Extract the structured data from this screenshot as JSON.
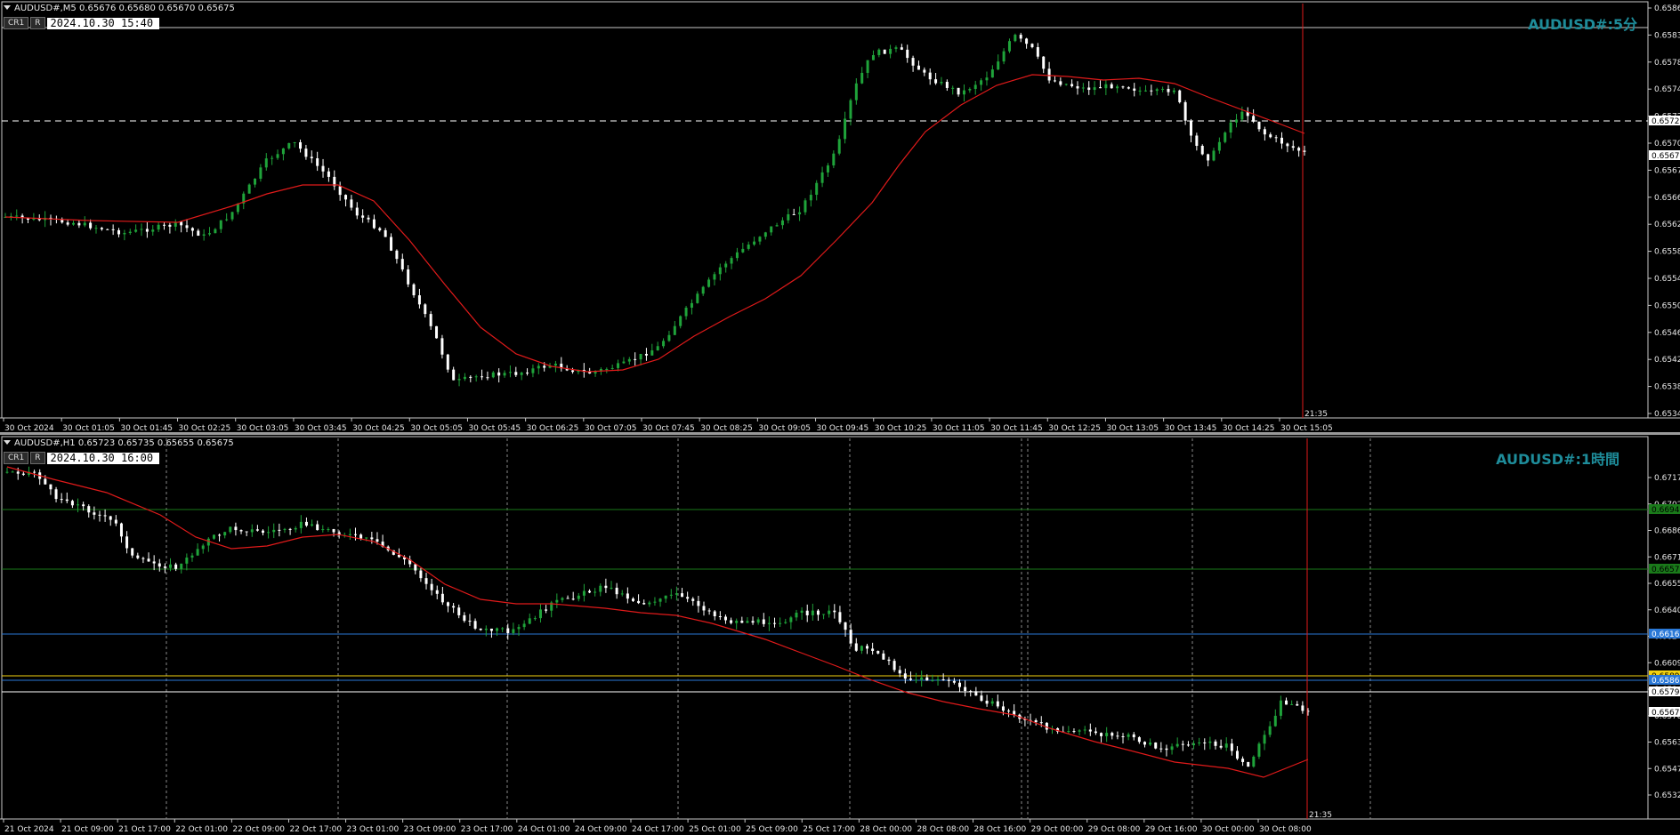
{
  "chart1": {
    "header": "AUDUSD#,M5  0.65676 0.65680 0.65670 0.65675",
    "btn_cr1": "CR1",
    "btn_r": "R",
    "datetime": "2024.10.30 15:40",
    "tf_label": "AUDUSD#:5分",
    "cursor_time": "21:35",
    "price_labels": [
      "0.65866",
      "0.65835",
      "0.65785",
      "0.65745",
      "0.65720",
      "0.65705",
      "0.65675",
      "0.65665",
      "0.65625",
      "0.65585",
      "0.65545",
      "0.65505",
      "0.65465",
      "0.65425",
      "0.65385",
      "0.65345"
    ],
    "time_labels": [
      "30 Oct 2024",
      "30 Oct 01:05",
      "30 Oct 01:45",
      "30 Oct 02:25",
      "30 Oct 03:05",
      "30 Oct 03:45",
      "30 Oct 04:25",
      "30 Oct 05:05",
      "30 Oct 05:45",
      "30 Oct 06:25",
      "30 Oct 07:05",
      "30 Oct 07:45",
      "30 Oct 08:25",
      "30 Oct 09:05",
      "30 Oct 09:45",
      "30 Oct 10:25",
      "30 Oct 11:05",
      "30 Oct 11:45",
      "30 Oct 12:25",
      "30 Oct 13:05",
      "30 Oct 13:45",
      "30 Oct 14:25",
      "30 Oct 15:05"
    ],
    "current_price": "0.65675",
    "dashed_level": "0.65720",
    "colors": {
      "bull": "#1fa33a",
      "bear": "#ffffff",
      "ma": "#e01a1a",
      "vline": "#e01a1a",
      "tf_label": "#1e8c9a"
    }
  },
  "chart2": {
    "header": "AUDUSD#,H1  0.65723 0.65735 0.65655 0.65675",
    "btn_cr1": "CR1",
    "btn_r": "R",
    "datetime": "2024.10.30 16:00",
    "tf_label": "AUDUSD#:1時間",
    "cursor_time": "21:35",
    "price_labels": [
      "0.67175",
      "0.67020",
      "0.66865",
      "0.66710",
      "0.66555",
      "0.66400",
      "0.66245",
      "0.66095",
      "0.65940",
      "0.65785",
      "0.65630",
      "0.65475",
      "0.65320"
    ],
    "level_labels": [
      {
        "text": "0.66947",
        "color": "#1a7a1a",
        "fg": "#000"
      },
      {
        "text": "0.66573",
        "color": "#1a7a1a",
        "fg": "#000"
      },
      {
        "text": "0.66160",
        "color": "#2a78d6",
        "fg": "#fff"
      },
      {
        "text": "0.65898",
        "color": "#f2d20f",
        "fg": "#000"
      },
      {
        "text": "0.65863",
        "color": "#2a78d6",
        "fg": "#fff"
      },
      {
        "text": "0.65797",
        "color": "#ffffff",
        "fg": "#000"
      },
      {
        "text": "0.65675",
        "color": "#ffffff",
        "fg": "#000"
      }
    ],
    "time_labels": [
      "21 Oct 2024",
      "21 Oct 09:00",
      "21 Oct 17:00",
      "22 Oct 01:00",
      "22 Oct 09:00",
      "22 Oct 17:00",
      "23 Oct 01:00",
      "23 Oct 09:00",
      "23 Oct 17:00",
      "24 Oct 01:00",
      "24 Oct 09:00",
      "24 Oct 17:00",
      "25 Oct 01:00",
      "25 Oct 09:00",
      "25 Oct 17:00",
      "28 Oct 00:00",
      "28 Oct 08:00",
      "28 Oct 16:00",
      "29 Oct 00:00",
      "29 Oct 08:00",
      "29 Oct 16:00",
      "30 Oct 00:00",
      "30 Oct 08:00"
    ],
    "colors": {
      "bull": "#1fa33a",
      "bear": "#ffffff",
      "ma": "#e01a1a",
      "vline": "#e01a1a",
      "tf_label": "#1e8c9a"
    }
  }
}
